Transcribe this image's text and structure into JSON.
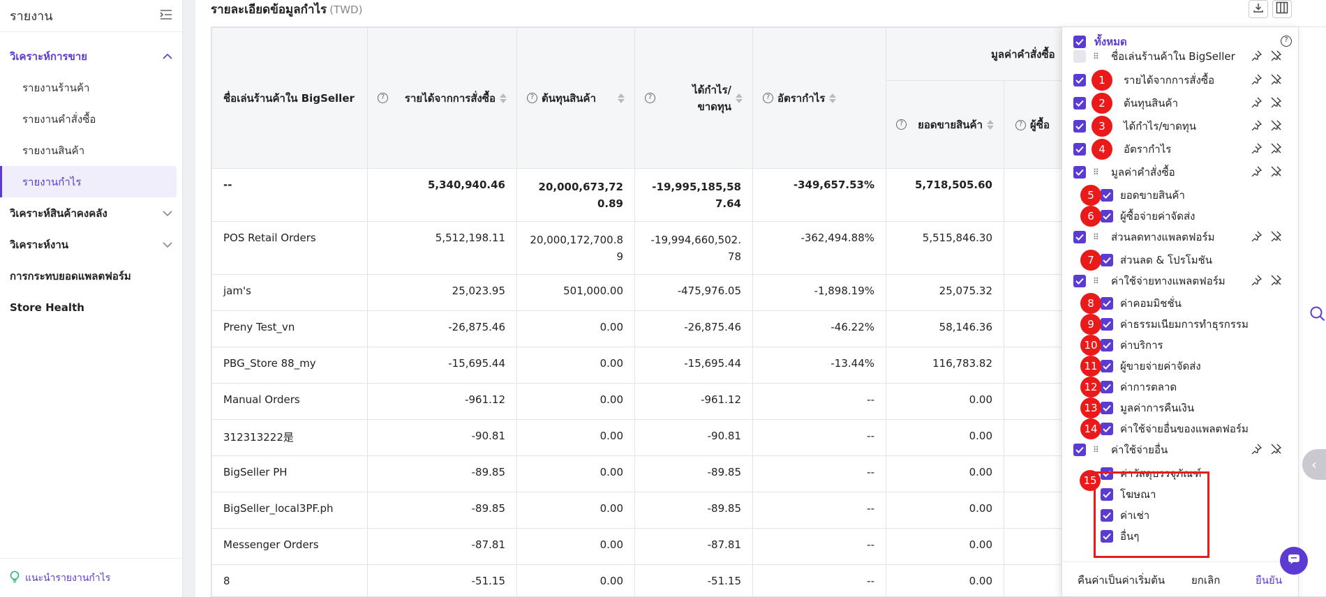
{
  "sidebar": {
    "title": "รายงาน",
    "groups": [
      {
        "label": "วิเคราะห์การขาย",
        "items": [
          "รายงานร้านค้า",
          "รายงานคำสั่งซื้อ",
          "รายงานสินค้า",
          "รายงานกำไร"
        ]
      },
      {
        "label": "วิเคราะห์สินค้าคงคลัง"
      },
      {
        "label": "วิเคราะห์งาน"
      },
      {
        "label": "การกระทบยอดแพลตฟอร์ม"
      },
      {
        "label": "Store Health"
      }
    ],
    "footer_link": "แนะนำรายงานกำไร"
  },
  "main": {
    "heading": "รายละเอียดข้อมูลกำไร",
    "unit": "(TWD)"
  },
  "table": {
    "headers": {
      "store": "ชื่อเล่นร้านค้าใน BigSeller",
      "revenue": "รายได้จากการสั่งซื้อ",
      "cost": "ต้นทุนสินค้า",
      "profit": "ได้กำไร/ขาดทุน",
      "margin": "อัตรากำไร",
      "order_value": "มูลค่าคำสั่งซื้อ",
      "sales": "ยอดขายสินค้า",
      "shipping_paid": "ผู้ซื้อ"
    },
    "rows": [
      {
        "name": "--",
        "revenue": "5,340,940.46",
        "cost": "20,000,673,720.89",
        "profit": "-19,995,185,587.64",
        "margin": "-349,657.53%",
        "sales": "5,718,505.60"
      },
      {
        "name": "POS Retail Orders",
        "revenue": "5,512,198.11",
        "cost": "20,000,172,700.89",
        "profit": "-19,994,660,502.78",
        "margin": "-362,494.88%",
        "sales": "5,515,846.30"
      },
      {
        "name": "jam's",
        "revenue": "25,023.95",
        "cost": "501,000.00",
        "profit": "-475,976.05",
        "margin": "-1,898.19%",
        "sales": "25,075.32"
      },
      {
        "name": "Preny Test_vn",
        "revenue": "-26,875.46",
        "cost": "0.00",
        "profit": "-26,875.46",
        "margin": "-46.22%",
        "sales": "58,146.36"
      },
      {
        "name": "PBG_Store 88_my",
        "revenue": "-15,695.44",
        "cost": "0.00",
        "profit": "-15,695.44",
        "margin": "-13.44%",
        "sales": "116,783.82"
      },
      {
        "name": "Manual Orders",
        "revenue": "-961.12",
        "cost": "0.00",
        "profit": "-961.12",
        "margin": "--",
        "sales": "0.00"
      },
      {
        "name": "312313222是",
        "revenue": "-90.81",
        "cost": "0.00",
        "profit": "-90.81",
        "margin": "--",
        "sales": "0.00"
      },
      {
        "name": "BigSeller PH",
        "revenue": "-89.85",
        "cost": "0.00",
        "profit": "-89.85",
        "margin": "--",
        "sales": "0.00"
      },
      {
        "name": "BigSeller_local3PF.ph",
        "revenue": "-89.85",
        "cost": "0.00",
        "profit": "-89.85",
        "margin": "--",
        "sales": "0.00"
      },
      {
        "name": "Messenger Orders",
        "revenue": "-87.81",
        "cost": "0.00",
        "profit": "-87.81",
        "margin": "--",
        "sales": "0.00"
      },
      {
        "name": "8",
        "revenue": "-51.15",
        "cost": "0.00",
        "profit": "-51.15",
        "margin": "--",
        "sales": "0.00"
      }
    ]
  },
  "column_panel": {
    "select_all": "ทั้งหมด",
    "items": [
      {
        "label": "ชื่อเล่นร้านค้าใน BigSeller",
        "badge": ""
      },
      {
        "label": "รายได้จากการสั่งซื้อ",
        "badge": "1"
      },
      {
        "label": "ต้นทุนสินค้า",
        "badge": "2"
      },
      {
        "label": "ได้กำไร/ขาดทุน",
        "badge": "3"
      },
      {
        "label": "อัตรากำไร",
        "badge": "4"
      },
      {
        "label": "มูลค่าคำสั่งซื้อ",
        "badge": ""
      },
      {
        "label": "ยอดขายสินค้า",
        "badge": "5"
      },
      {
        "label": "ผู้ซื้อจ่ายค่าจัดส่ง",
        "badge": "6"
      },
      {
        "label": "ส่วนลดทางแพลตฟอร์ม",
        "badge": ""
      },
      {
        "label": "ส่วนลด & โปรโมชัน",
        "badge": "7"
      },
      {
        "label": "ค่าใช้จ่ายทางแพลตฟอร์ม",
        "badge": ""
      },
      {
        "label": "ค่าคอมมิชชั่น",
        "badge": "8"
      },
      {
        "label": "ค่าธรรมเนียมการทำธุรกรรม",
        "badge": "9"
      },
      {
        "label": "ค่าบริการ",
        "badge": "10"
      },
      {
        "label": "ผู้ขายจ่ายค่าจัดส่ง",
        "badge": "11"
      },
      {
        "label": "ค่าการตลาด",
        "badge": "12"
      },
      {
        "label": "มูลค่าการคืนเงิน",
        "badge": "13"
      },
      {
        "label": "ค่าใช้จ่ายอื่นของแพลตฟอร์ม",
        "badge": "14"
      },
      {
        "label": "ค่าใช้จ่ายอื่น",
        "badge": ""
      },
      {
        "label": "ค่าวัสดุบรรจุภัณฑ์",
        "badge": "15"
      },
      {
        "label": "โฆษณา",
        "badge": ""
      },
      {
        "label": "ค่าเช่า",
        "badge": ""
      },
      {
        "label": "อื่นๆ",
        "badge": ""
      }
    ],
    "reset_label": "คืนค่าเป็นค่าเริ่มต้น",
    "cancel_label": "ยกเลิก",
    "confirm_label": "ยืนยัน"
  },
  "colors": {
    "accent": "#5b3bd1",
    "badge": "#ea1a1a"
  }
}
